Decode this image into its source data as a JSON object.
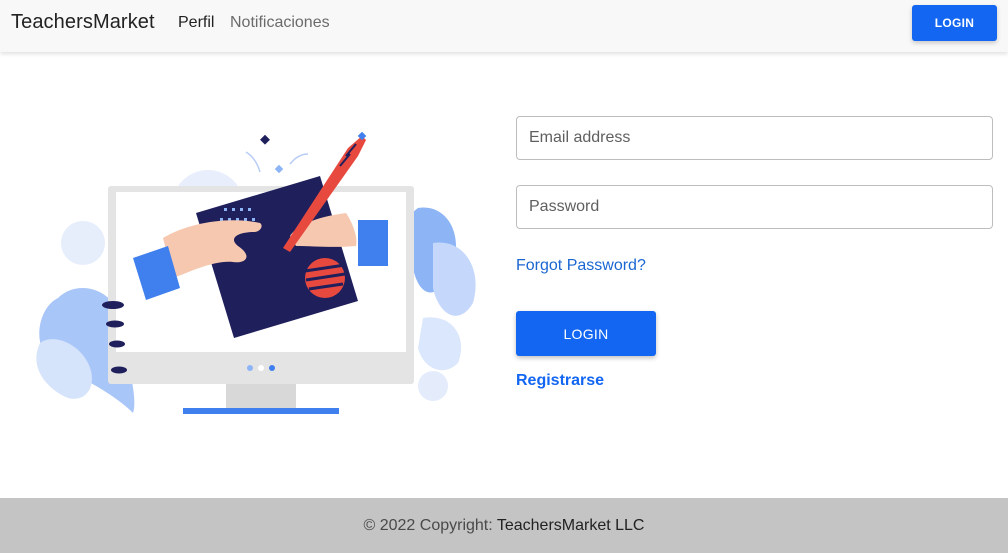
{
  "navbar": {
    "brand": "TeachersMarket",
    "links": [
      "Perfil",
      "Notificaciones"
    ],
    "login_label": "LOGIN"
  },
  "form": {
    "email_placeholder": "Email address",
    "password_placeholder": "Password",
    "forgot_label": "Forgot Password?",
    "login_label": "LOGIN",
    "register_label": "Registrarse"
  },
  "footer": {
    "prefix": "© 2022 Copyright: ",
    "owner": "TeachersMarket LLC"
  },
  "colors": {
    "primary": "#1266f1",
    "navbar_bg": "#f8f8f8",
    "footer_bg": "#c4c4c4",
    "illustration_navy": "#1f1f5c",
    "illustration_red": "#e8493f",
    "illustration_light_blue": "#8db4f5"
  },
  "icons": [
    "computer-illustration"
  ]
}
